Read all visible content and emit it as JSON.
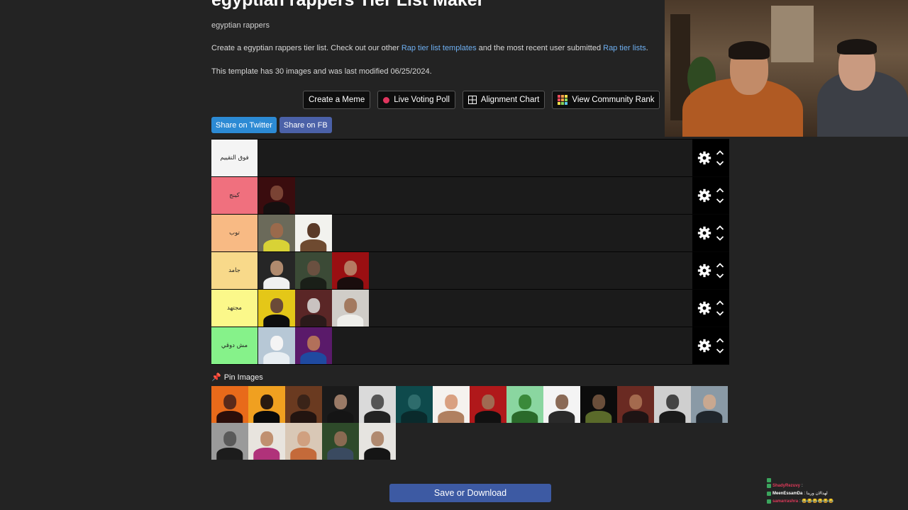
{
  "page": {
    "title": "egyptian rappers Tier List Maker",
    "subtitle": "egyptian rappers",
    "desc_prefix": "Create a egyptian rappers tier list. Check out our other ",
    "desc_link1": "Rap tier list templates",
    "desc_middle": " and the most recent user submitted ",
    "desc_link2": "Rap tier lists",
    "desc_suffix": ".",
    "meta": "This template has 30 images and was last modified 06/25/2024."
  },
  "actions": {
    "create_meme": "Create a Meme",
    "live_voting": "Live Voting Poll",
    "alignment_chart": "Alignment Chart",
    "community_rank": "View Community Rank"
  },
  "share": {
    "twitter": "Share on Twitter",
    "facebook": "Share on FB"
  },
  "tiers": [
    {
      "label": "فوق التقييم",
      "color": "#f4f4f4",
      "items": []
    },
    {
      "label": "كينج",
      "color": "#f0707e",
      "items": [
        {
          "bg": "#3a0c0e",
          "skin": "#7a4334",
          "shirt": "#151010"
        }
      ]
    },
    {
      "label": "توب",
      "color": "#f8ba84",
      "items": [
        {
          "bg": "#6b6a5a",
          "skin": "#9a6a4c",
          "shirt": "#d8d236"
        },
        {
          "bg": "#f2f2ee",
          "skin": "#5a3a28",
          "shirt": "#6e4a30"
        }
      ]
    },
    {
      "label": "جامد",
      "color": "#f8d98a",
      "items": [
        {
          "bg": "#262626",
          "skin": "#b08a6e",
          "shirt": "#f0f0f0"
        },
        {
          "bg": "#3b4a36",
          "skin": "#6a5040",
          "shirt": "#1a1f18"
        },
        {
          "bg": "#9a0f12",
          "skin": "#b57a62",
          "shirt": "#1a0d0d"
        }
      ]
    },
    {
      "label": "مجتهد",
      "color": "#fbf88a",
      "items": [
        {
          "bg": "#e4c718",
          "skin": "#6b4a38",
          "shirt": "#0e0e0e"
        },
        {
          "bg": "#5a2626",
          "skin": "#c9c2c0",
          "shirt": "#2a1a1a"
        },
        {
          "bg": "#d0cdc8",
          "skin": "#a37a60",
          "shirt": "#eeeeea"
        }
      ]
    },
    {
      "label": "مش دوقي",
      "color": "#86f28a",
      "items": [
        {
          "bg": "#b7c8d6",
          "skin": "#f4f4f4",
          "shirt": "#e8eef2"
        },
        {
          "bg": "#5a1a6a",
          "skin": "#b2705a",
          "shirt": "#1f4aa0"
        }
      ]
    }
  ],
  "pin_label": "Pin Images",
  "pool": [
    {
      "bg": "#e86a1a",
      "skin": "#5a2a1a",
      "shirt": "#2b0e0a"
    },
    {
      "bg": "#f0a020",
      "skin": "#2a1a10",
      "shirt": "#0a0a0a"
    },
    {
      "bg": "#6a3a20",
      "skin": "#3a2318",
      "shirt": "#221410"
    },
    {
      "bg": "#1a1a1a",
      "skin": "#9a7a66",
      "shirt": "#151515"
    },
    {
      "bg": "#dadada",
      "skin": "#555555",
      "shirt": "#222222"
    },
    {
      "bg": "#0e4a4c",
      "skin": "#2e6c6c",
      "shirt": "#0a2a2c"
    },
    {
      "bg": "#f5f2ee",
      "skin": "#d9a080",
      "shirt": "#b08060"
    },
    {
      "bg": "#b0181a",
      "skin": "#a06a52",
      "shirt": "#111111"
    },
    {
      "bg": "#8ad6a0",
      "skin": "#3a8a3a",
      "shirt": "#2a6a2a"
    },
    {
      "bg": "#f4f4f4",
      "skin": "#8a6a56",
      "shirt": "#2a2a2a"
    },
    {
      "bg": "#0c0c0c",
      "skin": "#6a4e3a",
      "shirt": "#5a6a2a"
    },
    {
      "bg": "#6a2a22",
      "skin": "#a46a4e",
      "shirt": "#1e1414"
    },
    {
      "bg": "#cfcfcf",
      "skin": "#444444",
      "shirt": "#1a1a1a"
    },
    {
      "bg": "#8a9aa6",
      "skin": "#c9a890",
      "shirt": "#20262c"
    },
    {
      "bg": "#9a9a9a",
      "skin": "#5a5a5a",
      "shirt": "#1c1c1c"
    },
    {
      "bg": "#e8e4de",
      "skin": "#c09070",
      "shirt": "#b0327a"
    },
    {
      "bg": "#d9c8b6",
      "skin": "#d0a080",
      "shirt": "#c46a3a"
    },
    {
      "bg": "#2e4a2a",
      "skin": "#8a6a52",
      "shirt": "#3a4a60"
    },
    {
      "bg": "#e6e4e0",
      "skin": "#b08a70",
      "shirt": "#151515"
    }
  ],
  "save_label": "Save or Download",
  "chat": [
    {
      "user": "",
      "msg": "",
      "color": "#6a1b2a"
    },
    {
      "user": "ShadyRezuvy",
      "msg": ":",
      "color": "#e03a5a"
    },
    {
      "user": "MeenEssamDa",
      "msg": ": لهدالان ورينا",
      "color": "#ffffff"
    },
    {
      "user": "samarrashra",
      "msg": ": 😂😂😂😂😂😂",
      "color": "#e03a5a"
    }
  ]
}
